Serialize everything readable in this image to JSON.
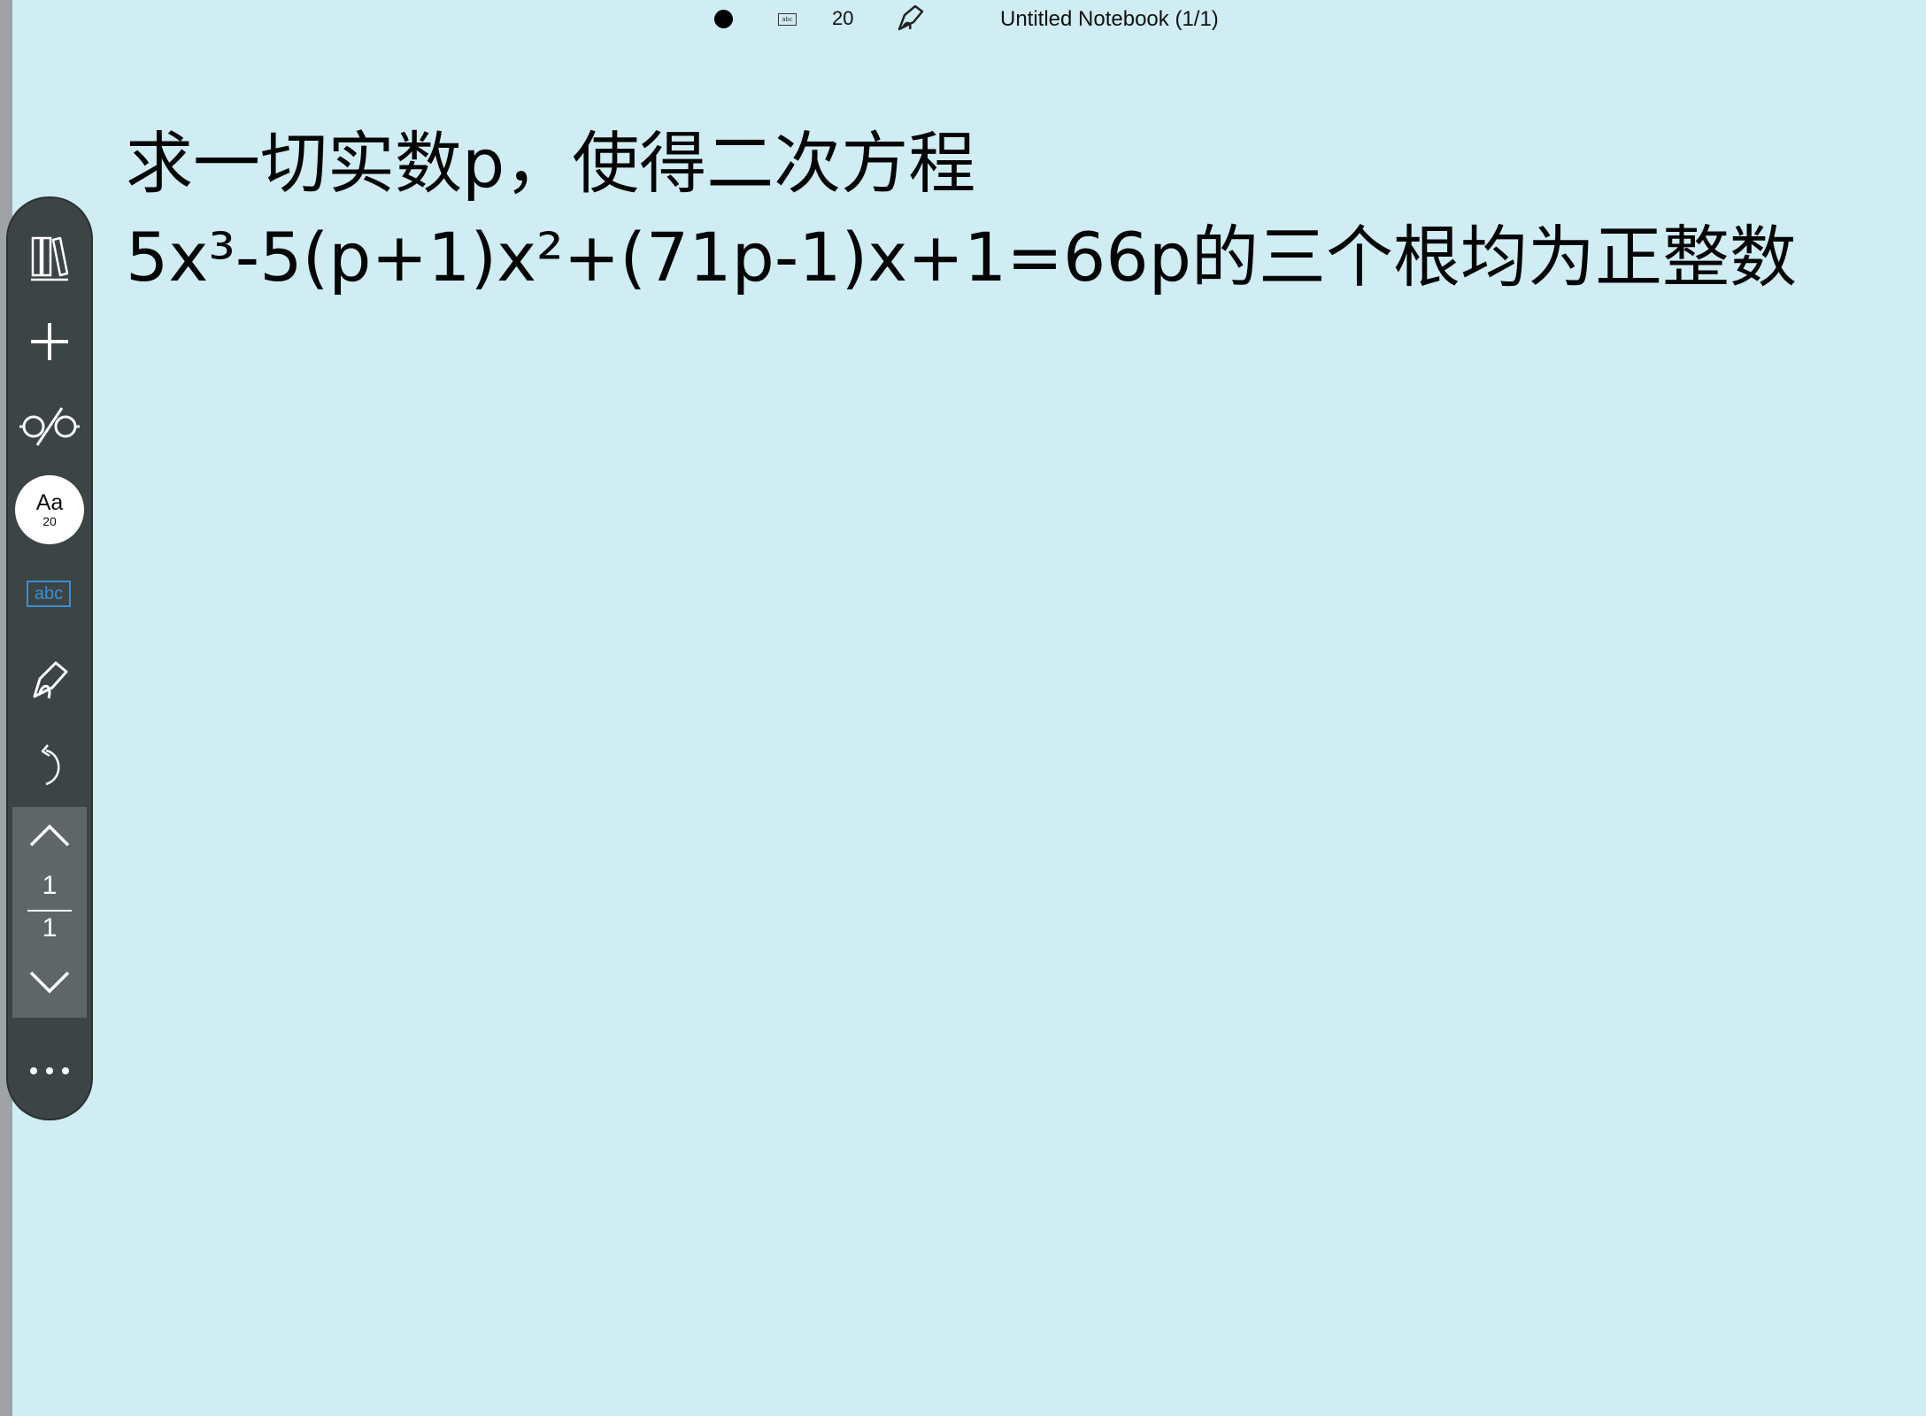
{
  "status_bar": {
    "font_size": "20",
    "notebook_title": "Untitled Notebook (1/1)",
    "abc_icon": "abc"
  },
  "note": {
    "line1": "求一切实数p，使得二次方程",
    "line2": "5x³-5(p+1)x²+(71p-1)x+1=66p的三个根均为正整数"
  },
  "toolbar": {
    "library_icon": "library-icon",
    "add_icon": "plus-icon",
    "view_icon": "glasses-icon",
    "font_label": "Aa",
    "font_size": "20",
    "text_mode_label": "abc",
    "pen_icon": "pen-icon",
    "undo_icon": "undo-icon",
    "page_current": "1",
    "page_total": "1",
    "more_label": "•••"
  },
  "colors": {
    "background": "#cfedf3",
    "toolbar": "#3c4446",
    "pager": "#5f6668",
    "accent_blue": "#3b8fd3"
  }
}
